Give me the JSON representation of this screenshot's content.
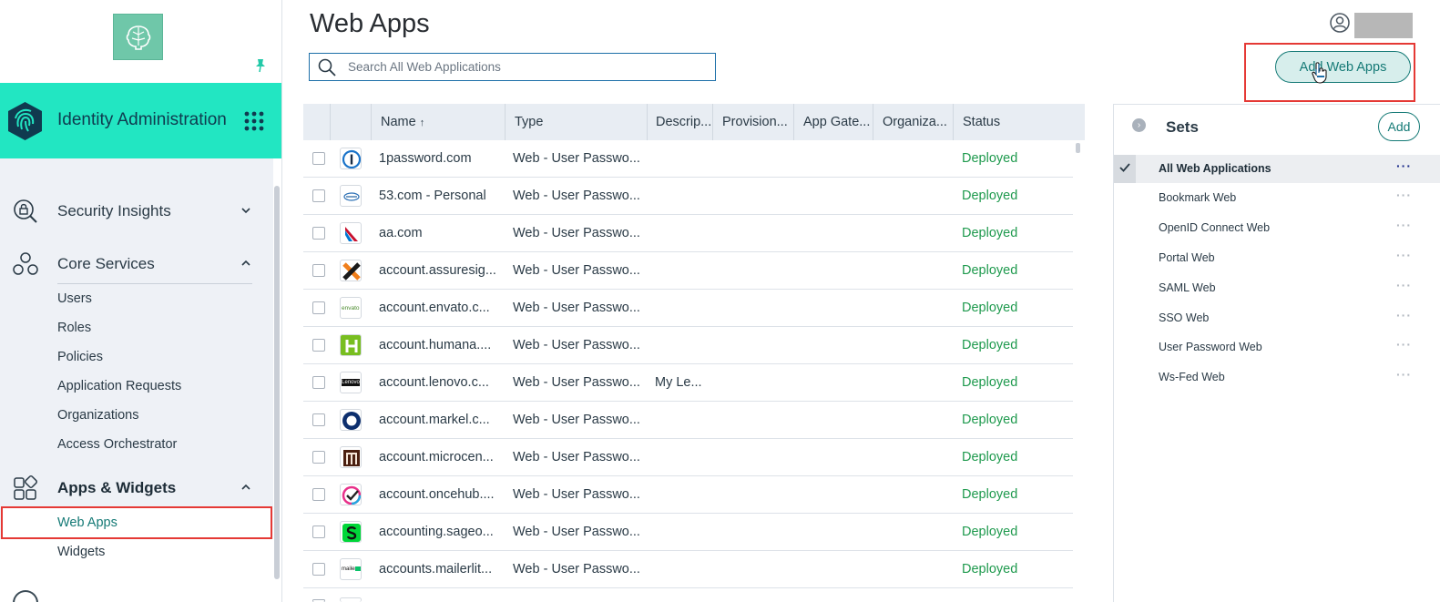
{
  "sidebar": {
    "brand_title": "Identity Administration",
    "sections": [
      {
        "label": "Security Insights",
        "icon": "security-insights-icon",
        "expanded": false
      },
      {
        "label": "Core Services",
        "icon": "core-services-icon",
        "expanded": true
      },
      {
        "label": "Apps & Widgets",
        "icon": "apps-widgets-icon",
        "expanded": true
      }
    ],
    "core_items": [
      "Users",
      "Roles",
      "Policies",
      "Application Requests",
      "Organizations",
      "Access Orchestrator"
    ],
    "apps_items": [
      "Web Apps",
      "Widgets"
    ]
  },
  "header": {
    "title": "Web Apps",
    "search_placeholder": "Search All Web Applications",
    "add_button": "Add Web Apps"
  },
  "table": {
    "columns": [
      "Name",
      "Type",
      "Descrip...",
      "Provision...",
      "App Gate...",
      "Organiza...",
      "Status"
    ],
    "sort_indicator": "↑",
    "rows": [
      {
        "name": "1password.com",
        "type": "Web - User Passwo...",
        "desc": "",
        "status": "Deployed"
      },
      {
        "name": "53.com - Personal",
        "type": "Web - User Passwo...",
        "desc": "",
        "status": "Deployed"
      },
      {
        "name": "aa.com",
        "type": "Web - User Passwo...",
        "desc": "",
        "status": "Deployed"
      },
      {
        "name": "account.assuresig...",
        "type": "Web - User Passwo...",
        "desc": "",
        "status": "Deployed"
      },
      {
        "name": "account.envato.c...",
        "type": "Web - User Passwo...",
        "desc": "",
        "status": "Deployed"
      },
      {
        "name": "account.humana....",
        "type": "Web - User Passwo...",
        "desc": "",
        "status": "Deployed"
      },
      {
        "name": "account.lenovo.c...",
        "type": "Web - User Passwo...",
        "desc": "My Le...",
        "status": "Deployed"
      },
      {
        "name": "account.markel.c...",
        "type": "Web - User Passwo...",
        "desc": "",
        "status": "Deployed"
      },
      {
        "name": "account.microcen...",
        "type": "Web - User Passwo...",
        "desc": "",
        "status": "Deployed"
      },
      {
        "name": "account.oncehub....",
        "type": "Web - User Passwo...",
        "desc": "",
        "status": "Deployed"
      },
      {
        "name": "accounting.sageo...",
        "type": "Web - User Passwo...",
        "desc": "",
        "status": "Deployed"
      },
      {
        "name": "accounts.mailerlit...",
        "type": "Web - User Passwo...",
        "desc": "",
        "status": "Deployed"
      }
    ],
    "logo_text": {
      "envato": "envato",
      "lenovo": "Lenovo",
      "mailerlite": "mailer"
    }
  },
  "sets": {
    "title": "Sets",
    "add_label": "Add",
    "more_label": "···",
    "items": [
      "All Web Applications",
      "Bookmark Web",
      "OpenID Connect Web",
      "Portal Web",
      "SAML Web",
      "SSO Web",
      "User Password Web",
      "Ws-Fed Web"
    ]
  },
  "colors": {
    "brand": "#22e6c2",
    "accent": "#157a76",
    "status_deployed": "#1f9a4e",
    "highlight": "#e53935"
  }
}
